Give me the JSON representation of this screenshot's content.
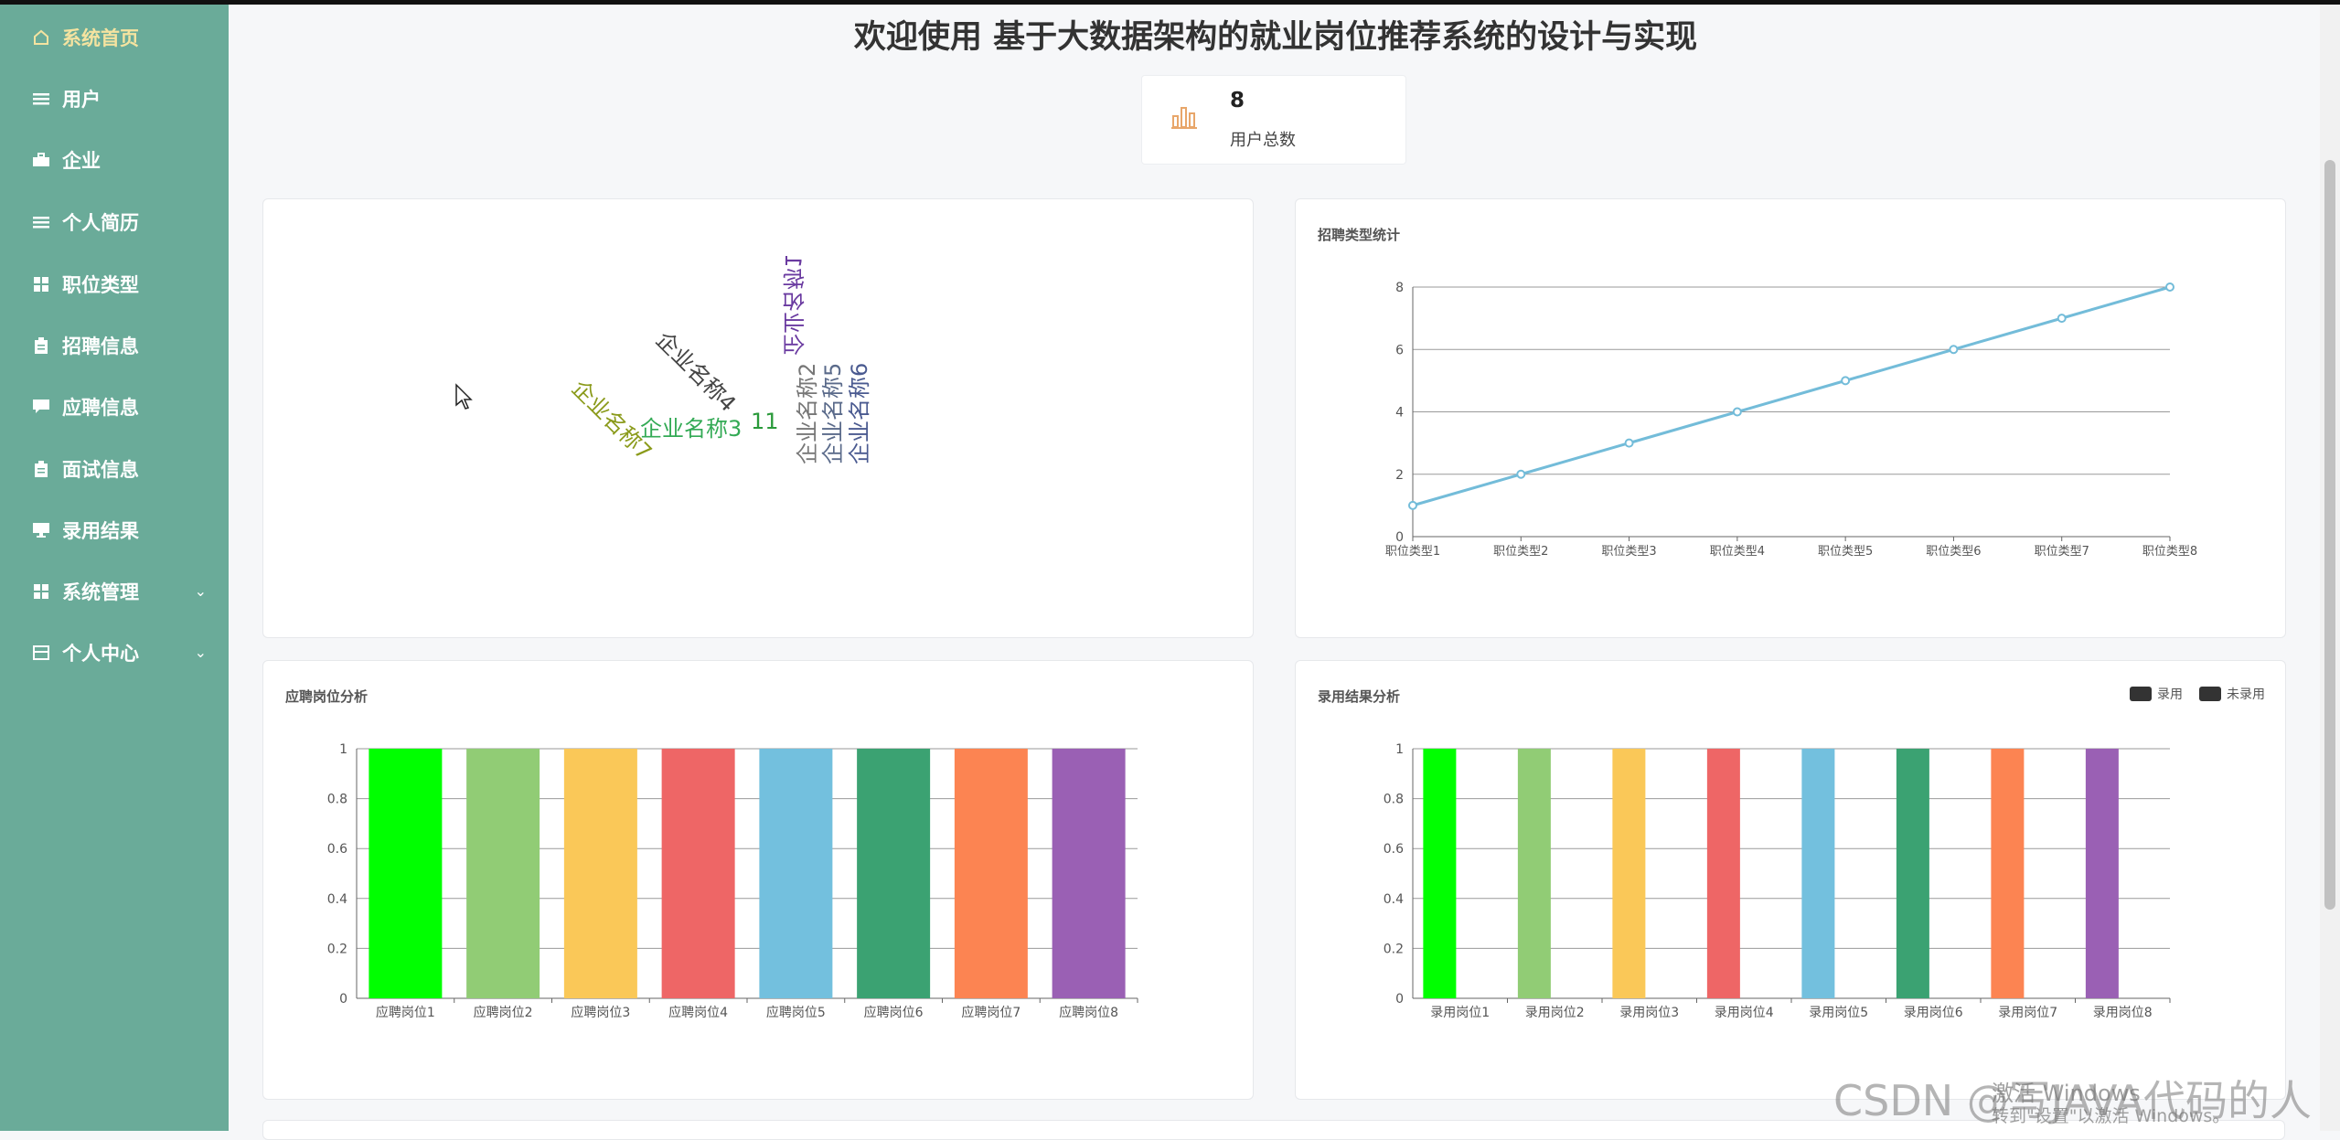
{
  "sidebar": {
    "items": [
      {
        "label": "系统首页",
        "icon": "home-icon"
      },
      {
        "label": "用户",
        "icon": "list-icon"
      },
      {
        "label": "企业",
        "icon": "briefcase-icon"
      },
      {
        "label": "个人简历",
        "icon": "list-icon"
      },
      {
        "label": "职位类型",
        "icon": "grid-icon"
      },
      {
        "label": "招聘信息",
        "icon": "clipboard-icon"
      },
      {
        "label": "应聘信息",
        "icon": "message-icon"
      },
      {
        "label": "面试信息",
        "icon": "clipboard-icon"
      },
      {
        "label": "录用结果",
        "icon": "monitor-icon"
      },
      {
        "label": "系统管理",
        "icon": "grid-icon"
      },
      {
        "label": "个人中心",
        "icon": "card-icon"
      }
    ],
    "active_color": "#f4e3a0",
    "bg_color": "#6aab99"
  },
  "header": {
    "title": "欢迎使用 基于大数据架构的就业岗位推荐系统的设计与实现"
  },
  "stat": {
    "value": "8",
    "label": "用户总数"
  },
  "wordcloud": {
    "words": [
      {
        "text": "企业名称4",
        "color": "#444444"
      },
      {
        "text": "企业名称7",
        "color": "#8a9a1a"
      },
      {
        "text": "企业名称3",
        "color": "#33aa55"
      },
      {
        "text": "11",
        "color": "#2a9a3a"
      },
      {
        "text": "企业名称1",
        "color": "#6a3aa0"
      },
      {
        "text": "企业名称2",
        "color": "#777777"
      },
      {
        "text": "企业名称5",
        "color": "#5a6a8a"
      },
      {
        "text": "企业名称6",
        "color": "#4a5a90"
      }
    ]
  },
  "panels": {
    "line_title": "招聘类型统计",
    "bar1_title": "应聘岗位分析",
    "bar2_title": "录用结果分析",
    "bar2_legend": [
      "录用",
      "未录用"
    ]
  },
  "chart_data": [
    {
      "type": "line",
      "title": "招聘类型统计",
      "categories": [
        "职位类型1",
        "职位类型2",
        "职位类型3",
        "职位类型4",
        "职位类型5",
        "职位类型6",
        "职位类型7",
        "职位类型8"
      ],
      "values": [
        1,
        2,
        3,
        4,
        5,
        6,
        7,
        8
      ],
      "ylim": [
        0,
        8
      ],
      "yticks": [
        "0",
        "2",
        "4",
        "6",
        "8"
      ],
      "color": "#73bcd9",
      "grid": true
    },
    {
      "type": "bar",
      "title": "应聘岗位分析",
      "categories": [
        "应聘岗位1",
        "应聘岗位2",
        "应聘岗位3",
        "应聘岗位4",
        "应聘岗位5",
        "应聘岗位6",
        "应聘岗位7",
        "应聘岗位8"
      ],
      "values": [
        1,
        1,
        1,
        1,
        1,
        1,
        1,
        1
      ],
      "ylim": [
        0,
        1
      ],
      "yticks": [
        "0",
        "0.2",
        "0.4",
        "0.6",
        "0.8",
        "1"
      ],
      "colors": [
        "#00ff00",
        "#91cc75",
        "#fac858",
        "#ee6666",
        "#73c0de",
        "#3ba272",
        "#fc8452",
        "#9a60b4"
      ],
      "grid": true
    },
    {
      "type": "bar",
      "title": "录用结果分析",
      "categories": [
        "录用岗位1",
        "录用岗位2",
        "录用岗位3",
        "录用岗位4",
        "录用岗位5",
        "录用岗位6",
        "录用岗位7",
        "录用岗位8"
      ],
      "series": [
        {
          "name": "录用",
          "values": [
            1,
            1,
            1,
            1,
            1,
            1,
            1,
            1
          ]
        },
        {
          "name": "未录用",
          "values": [
            0,
            0,
            0,
            0,
            0,
            0,
            0,
            0
          ]
        }
      ],
      "ylim": [
        0,
        1
      ],
      "yticks": [
        "0",
        "0.2",
        "0.4",
        "0.6",
        "0.8",
        "1"
      ],
      "colors": [
        "#00ff00",
        "#91cc75",
        "#fac858",
        "#ee6666",
        "#73c0de",
        "#3ba272",
        "#fc8452",
        "#9a60b4"
      ],
      "legend": "top-right",
      "grid": true
    }
  ],
  "overlay": {
    "watermark": "CSDN @写JAVA代码的人",
    "windows_line1": "激活 Windows",
    "windows_line2": "转到\"设置\"以激活 Windows。"
  }
}
